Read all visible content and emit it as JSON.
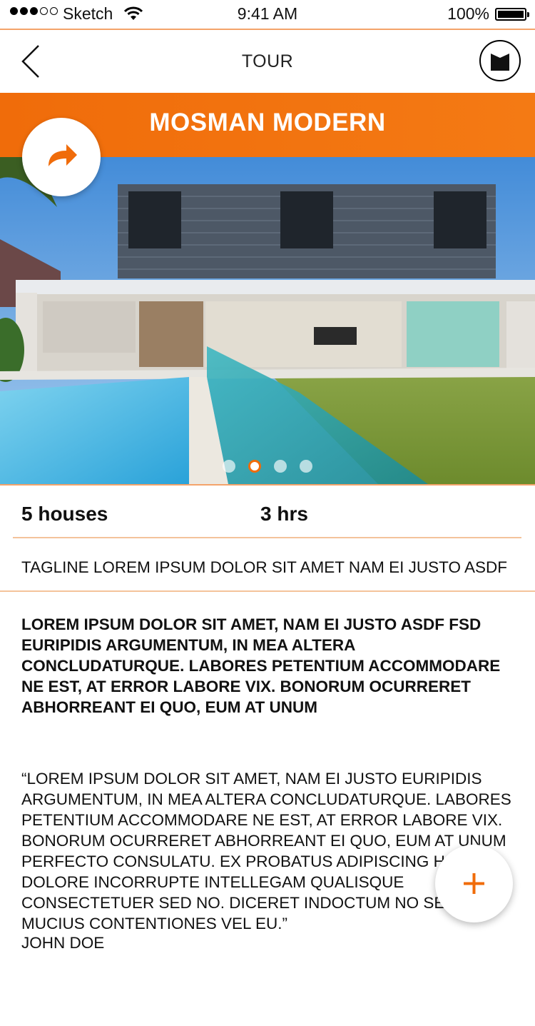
{
  "status_bar": {
    "carrier": "Sketch",
    "time": "9:41 AM",
    "battery": "100%"
  },
  "nav": {
    "title": "TOUR",
    "back_icon": "chevron-left-icon",
    "book_icon": "book-icon"
  },
  "hero": {
    "title": "MOSMAN MODERN",
    "share_icon": "share-arrow-icon",
    "accent_color": "#f06c0a",
    "page_count": 4,
    "active_page": 2
  },
  "stats": {
    "houses": "5 houses",
    "duration": "3 hrs"
  },
  "tagline": "TAGLINE LOREM IPSUM DOLOR SIT AMET NAM EI JUSTO ASDF",
  "description": "LOREM IPSUM DOLOR SIT AMET, NAM EI JUSTO ASDF FSD EURIPIDIS ARGUMENTUM, IN MEA ALTERA CONCLUDATURQUE. LABORES PETENTIUM ACCOMMODARE NE EST, AT ERROR LABORE VIX. BONORUM OCURRERET ABHORREANT EI QUO, EUM AT UNUM",
  "quote": "“LOREM IPSUM DOLOR SIT AMET, NAM EI JUSTO EURIPIDIS ARGUMENTUM, IN MEA ALTERA CONCLUDATURQUE. LABORES PETENTIUM ACCOMMODARE NE EST, AT ERROR LABORE VIX. BONORUM OCURRERET ABHORREANT EI QUO, EUM AT UNUM PERFECTO CONSULATU. EX PROBATUS ADIPISCING HAS, DOLORE INCORRUPTE INTELLEGAM QUALISQUE CONSECTETUER SED NO. DICERET INDOCTUM NO SEA, ODIO MUCIUS CONTENTIONES VEL EU.”",
  "author": "JOHN DOE",
  "fab": {
    "icon": "plus-icon"
  }
}
